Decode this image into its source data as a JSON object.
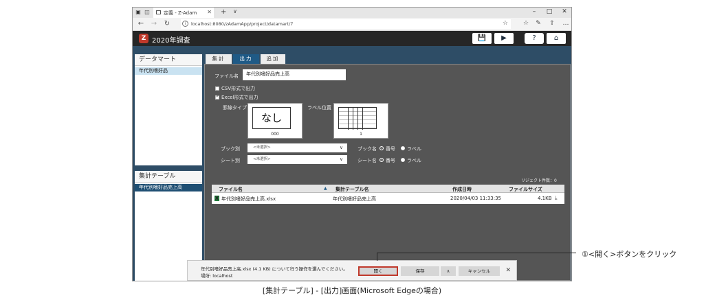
{
  "browser": {
    "tab_title": "定義 - Z-Adam",
    "url": "localhost:8080/zAdamApp/project/datamart/7"
  },
  "app": {
    "title": "2020年調査",
    "logo_letter": "Z",
    "save_icon": "💾",
    "run_icon": "▶",
    "help_icon": "?",
    "home_icon": "⌂"
  },
  "sidebar": {
    "datamart_header": "データマート",
    "datamart_selected": "年代別嗜好品",
    "table_header": "集計テーブル",
    "table_selected": "年代別嗜好品売上高"
  },
  "tabs": [
    {
      "label": "集計",
      "active": false
    },
    {
      "label": "出力",
      "active": true
    },
    {
      "label": "追加",
      "active": false
    }
  ],
  "form": {
    "filename_label": "ファイル名",
    "filename_value": "年代別嗜好品売上高",
    "csv_label": "CSV形式で出力",
    "csv_checked": false,
    "excel_label": "Excel形式で出力",
    "excel_checked": true,
    "border_type_label": "罫線タイプ",
    "border_type_value": "なし",
    "border_type_code": "000",
    "label_pos_label": "ラベル位置",
    "label_pos_code": "1",
    "book_label": "ブック別",
    "book_placeholder": "<未選択>",
    "sheet_label": "シート別",
    "sheet_placeholder": "<未選択>",
    "book_name_label": "ブック名",
    "sheet_name_label": "シート名",
    "radio_number": "番号",
    "radio_label": "ラベル",
    "reject_count": "リジェクト件数：0"
  },
  "grid": {
    "columns": [
      "ファイル名",
      "集計テーブル名",
      "作成日時",
      "ファイルサイズ"
    ],
    "sort_icon": "▲",
    "rows": [
      {
        "file": "年代別嗜好品売上高.xlsx",
        "table": "年代別嗜好品売上高",
        "created": "2020/04/03 11:33:35",
        "size": "4.1KB"
      }
    ]
  },
  "download_bar": {
    "message": "年代別嗜好品売上高.xlsx (4.1 KB) について行う操作を選んでください。",
    "location": "場所: localhost",
    "open": "開く",
    "save": "保存",
    "expand": "∧",
    "cancel": "キャンセル"
  },
  "annotation": "①<開く>ボタンをクリック",
  "caption": "[集計テーブル] - [出力]画面(Microsoft Edgeの場合)"
}
